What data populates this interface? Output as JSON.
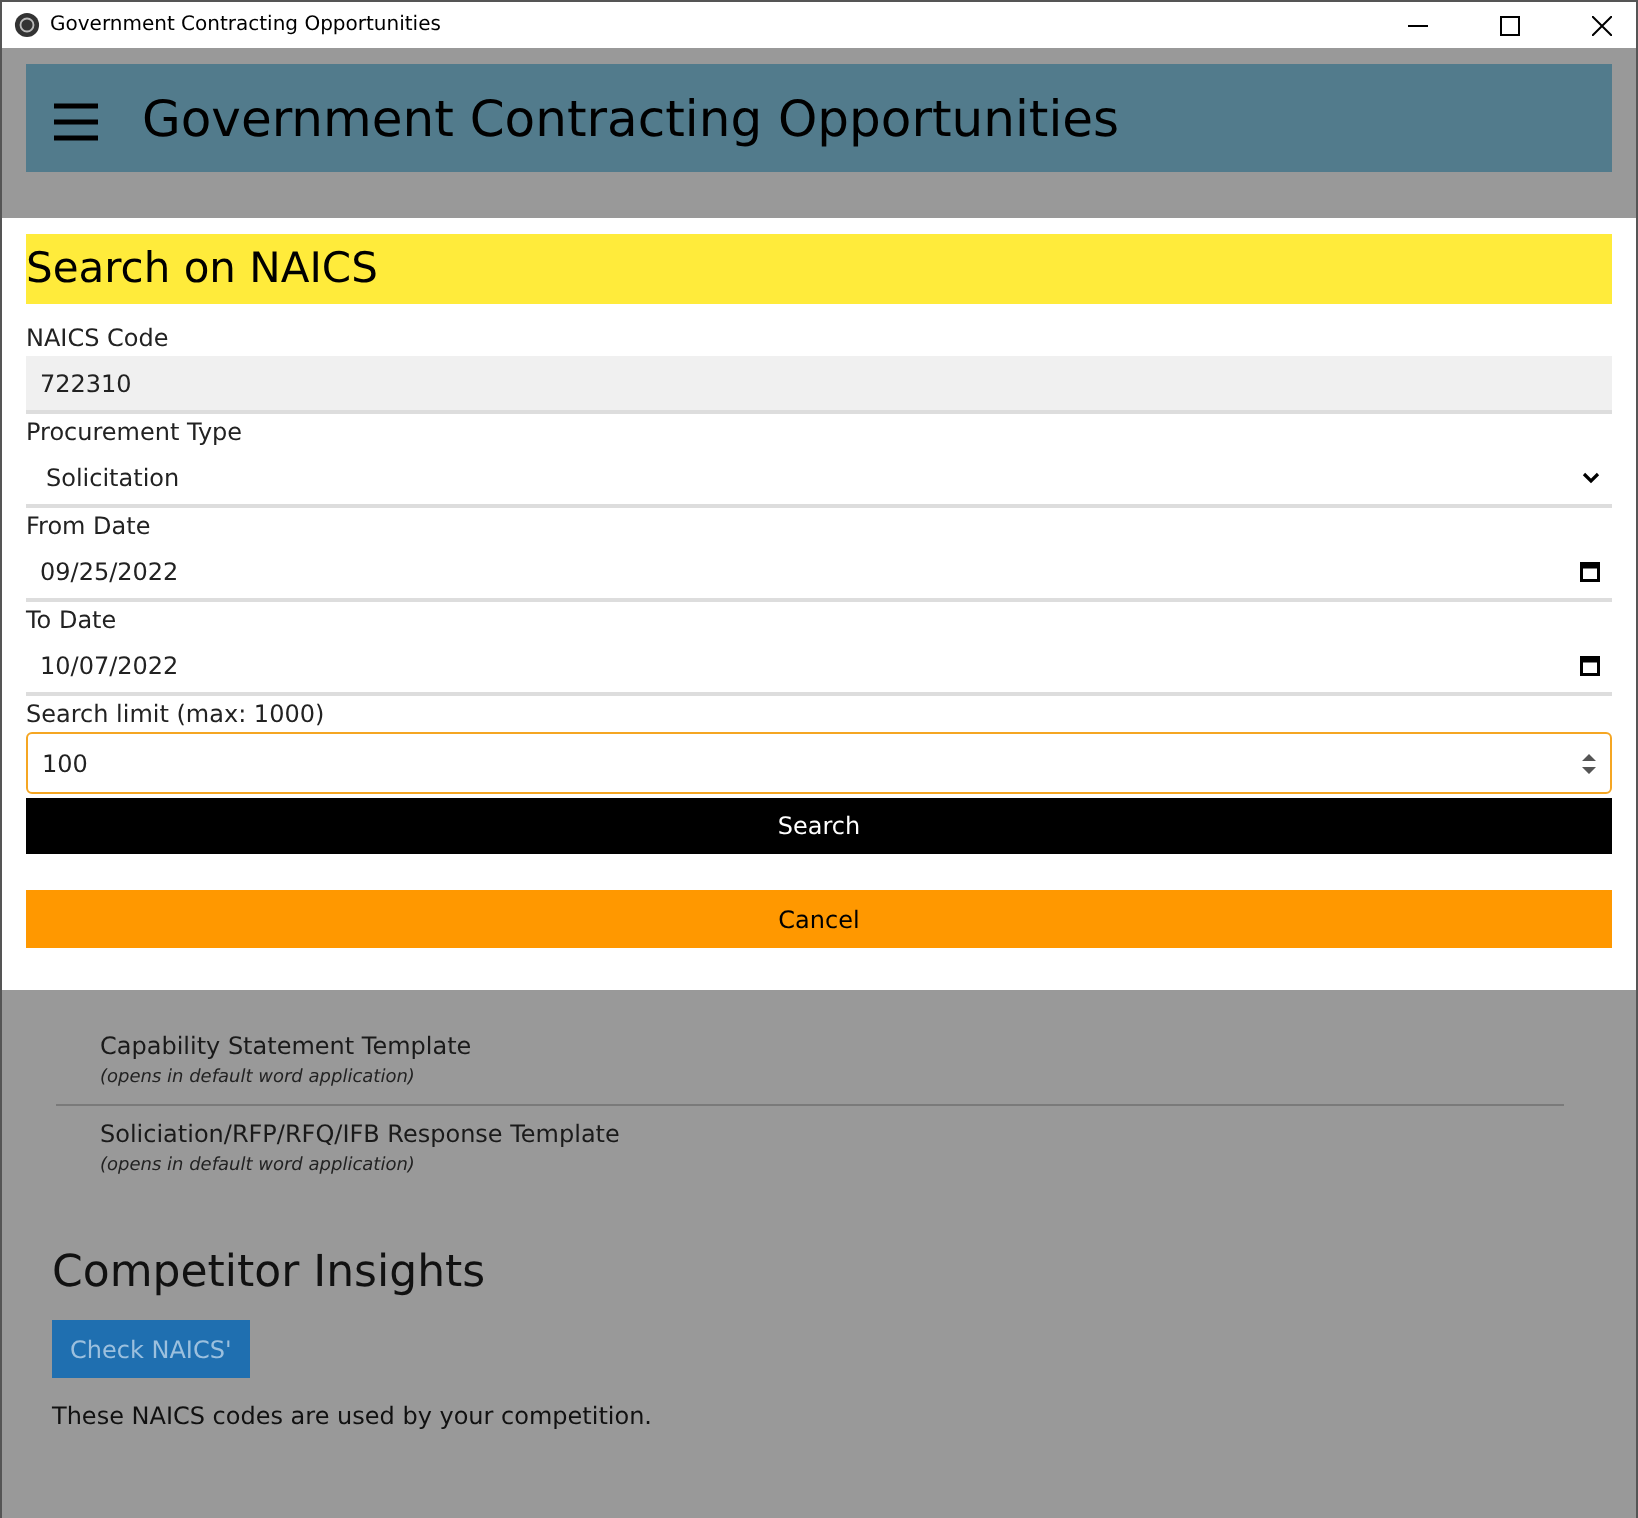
{
  "window": {
    "title": "Government Contracting Opportunities"
  },
  "app_bar": {
    "title": "Government Contracting Opportunities"
  },
  "documents": {
    "items": [
      {
        "title": "Capability Statement Template",
        "note": "(opens in default word application)"
      },
      {
        "title": "Soliciation/RFP/RFQ/IFB Response Template",
        "note": "(opens in default word application)"
      }
    ]
  },
  "competitor_insights": {
    "heading": "Competitor Insights",
    "button": "Check NAICS'",
    "text": "These NAICS codes are used by your competition."
  },
  "dialog": {
    "title": "Search on NAICS",
    "fields": [
      {
        "kind": "text",
        "label": "NAICS Code",
        "value": "722310",
        "disabled": true,
        "focused": false
      },
      {
        "kind": "select",
        "label": "Procurement Type",
        "value": "Solicitation",
        "disabled": false,
        "focused": false
      },
      {
        "kind": "date",
        "label": "From Date",
        "value": "09/25/2022",
        "disabled": false,
        "focused": false
      },
      {
        "kind": "date",
        "label": "To Date",
        "value": "10/07/2022",
        "disabled": false,
        "focused": false
      },
      {
        "kind": "number",
        "label": "Search limit (max: 1000)",
        "value": "100",
        "disabled": false,
        "focused": true
      }
    ],
    "buttons": [
      {
        "kind": "primary",
        "label": "Search"
      },
      {
        "kind": "cancel",
        "label": "Cancel"
      }
    ]
  }
}
